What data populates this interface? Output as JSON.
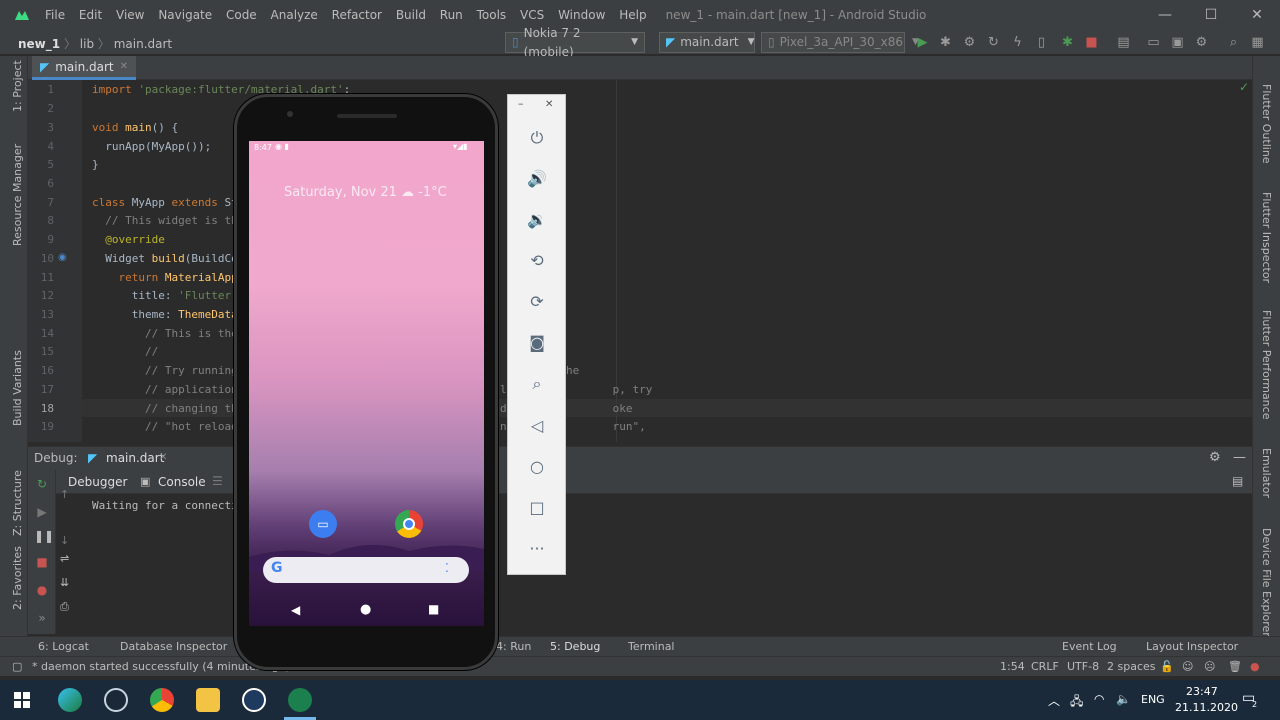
{
  "window": {
    "menu": [
      "File",
      "Edit",
      "View",
      "Navigate",
      "Code",
      "Analyze",
      "Refactor",
      "Build",
      "Run",
      "Tools",
      "VCS",
      "Window",
      "Help"
    ],
    "title": "new_1 - main.dart [new_1] - Android Studio",
    "controls": [
      "—",
      "☐",
      "✕"
    ]
  },
  "navbar": {
    "project": "new_1",
    "folder": "lib",
    "file": "main.dart",
    "device": "Nokia 7 2 (mobile)",
    "run_config": "main.dart",
    "avd": "Pixel_3a_API_30_x86"
  },
  "left_strip": [
    "1: Project",
    "Resource Manager",
    "Build Variants",
    "Z: Structure",
    "2: Favorites"
  ],
  "right_strip": [
    "Flutter Outline",
    "Flutter Inspector",
    "Flutter Performance",
    "Emulator",
    "Device File Explorer"
  ],
  "editor": {
    "tab": "main.dart",
    "line_numbers": [
      "1",
      "2",
      "3",
      "4",
      "5",
      "6",
      "7",
      "8",
      "9",
      "10",
      "11",
      "12",
      "13",
      "14",
      "15",
      "16",
      "17",
      "18",
      "19"
    ],
    "lines": {
      "l1_a": "import ",
      "l1_b": "'package:flutter/material.dart'",
      "l1_c": ";",
      "l3_a": "void ",
      "l3_b": "main",
      "l3_c": "() {",
      "l4": "  runApp(MyApp());",
      "l5": "}",
      "l7_a": "class ",
      "l7_b": "MyApp ",
      "l7_c": "extends ",
      "l7_d": "St",
      "l8": "  // This widget is th",
      "l9": "  @override",
      "l10_a": "  Widget ",
      "l10_b": "build",
      "l10_c": "(BuildCo",
      "l11_a": "    return ",
      "l11_b": "MaterialApp",
      "l12_a": "      title: ",
      "l12_b": "'Flutter",
      "l13_a": "      theme: ",
      "l13_b": "ThemeData",
      "l14": "        // This is the",
      "l15": "        //",
      "l16": "        // Try running",
      "l17": "        // application",
      "l18": "        // changing th",
      "l19": "        // \"hot reload"
    },
    "behind": {
      "r16": "he",
      "r17": "l                p, try",
      "r18": "d                oke",
      "r19": "n                run\","
    }
  },
  "debug": {
    "label": "Debug:",
    "config": "main.dart",
    "tabs": [
      "Debugger",
      "Console"
    ],
    "console_text": "Waiting for a connecti"
  },
  "bottom_tools": {
    "logcat": "6: Logcat",
    "db": "Database Inspector",
    "run": "4: Run",
    "debug": "5: Debug",
    "terminal": "Terminal",
    "event_log": "Event Log",
    "layout_inspector": "Layout Inspector"
  },
  "status": {
    "message": "* daemon started successfully (4 minutes ago)",
    "position": "1:54",
    "line_sep": "CRLF",
    "encoding": "UTF-8",
    "indent": "2 spaces"
  },
  "phone": {
    "time": "8:47",
    "date_weather": "Saturday, Nov 21 ☁ -1°C"
  },
  "taskbar": {
    "lang": "ENG",
    "time": "23:47",
    "date": "21.11.2020",
    "notif": "2"
  },
  "colors": {
    "accent": "#4a88c7",
    "run_green": "#499c54",
    "stop_red": "#c75450"
  }
}
